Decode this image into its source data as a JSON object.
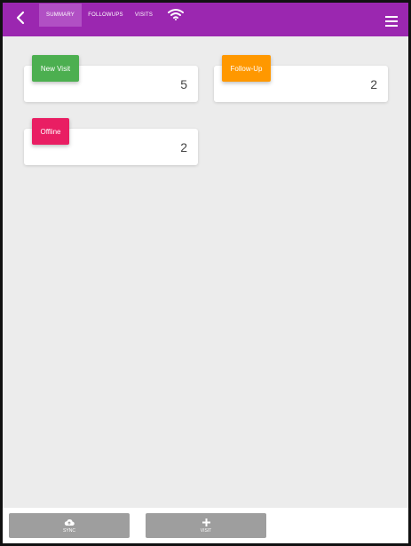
{
  "header": {
    "tabs": [
      {
        "label": "SUMMARY"
      },
      {
        "label": "FOLLOWUPS"
      },
      {
        "label": "VISITS"
      }
    ],
    "icons": {
      "back": "chevron-left-icon",
      "wifi": "wifi-icon",
      "menu": "hamburger-menu-icon"
    },
    "colors": {
      "appbar": "#9b27b0",
      "active_tab": "#b150c4"
    }
  },
  "cards": [
    {
      "tag": "New Visit",
      "count": "5",
      "color": "#4caf50"
    },
    {
      "tag": "Follow-Up",
      "count": "2",
      "color": "#ff9800"
    },
    {
      "tag": "Offline",
      "count": "2",
      "color": "#e91e63"
    }
  ],
  "bottom": {
    "sync_label": "SYNC",
    "visit_label": "VISIT",
    "icons": {
      "sync": "cloud-upload-icon",
      "visit": "plus-icon"
    }
  }
}
